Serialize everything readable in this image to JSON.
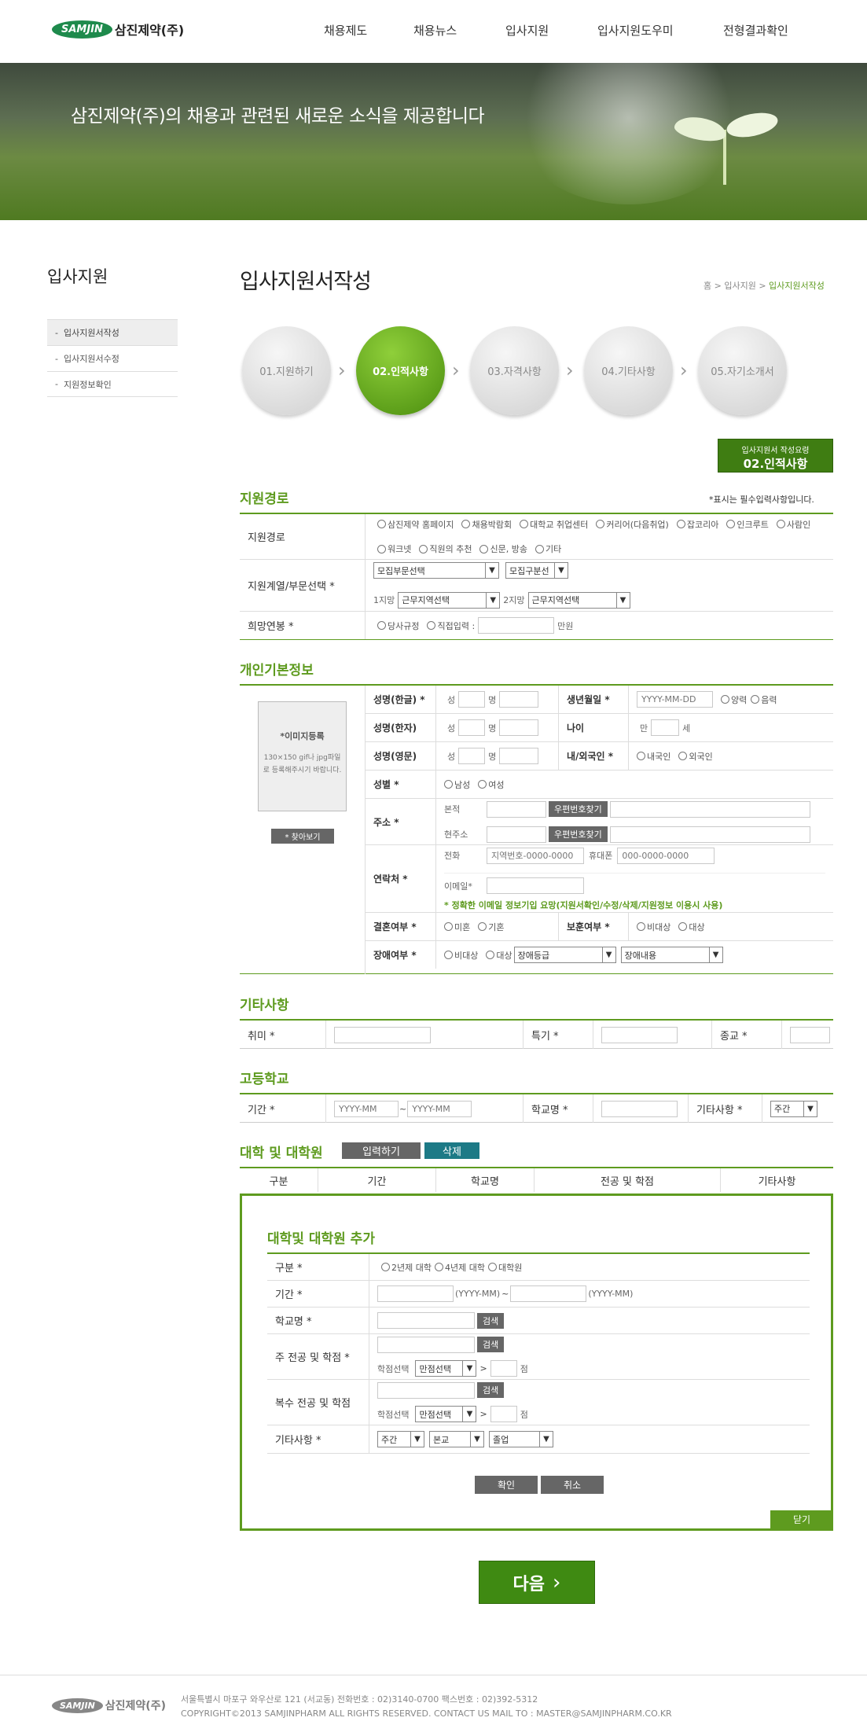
{
  "header": {
    "logo_badge": "SAMJIN",
    "logo_text": "삼진제약(주)",
    "nav": [
      "채용제도",
      "채용뉴스",
      "입사지원",
      "입사지원도우미",
      "전형결과확인"
    ]
  },
  "banner": {
    "text": "삼진제약(주)의 채용과 관련된 새로운 소식을 제공합니다"
  },
  "sidebar": {
    "title": "입사지원",
    "items": [
      "입사지원서작성",
      "입사지원서수정",
      "지원정보확인"
    ]
  },
  "page": {
    "title": "입사지원서작성",
    "breadcrumb": [
      "홈",
      "입사지원",
      "입사지원서작성"
    ]
  },
  "steps": [
    "01.지원하기",
    "02.인적사항",
    "03.자격사항",
    "04.기타사항",
    "05.자기소개서"
  ],
  "guide_button": {
    "line1": "입사지원서 작성요령",
    "line2": "02.인적사항"
  },
  "section_route": {
    "title": "지원경로",
    "required_note": "*표시는 필수입력사항입니다.",
    "route_label": "지원경로",
    "route_options": [
      "삼진제약 홈페이지",
      "채용박람회",
      "대학교 취업센터",
      "커리어(다음취업)",
      "잡코리아",
      "인크루트",
      "사람인",
      "워크넷",
      "직원의 추천",
      "신문, 방송",
      "기타"
    ],
    "dept_label": "지원계열/부문선택 *",
    "dept_select1": "모집부문선택",
    "dept_select2": "모집구분선",
    "pref1_label": "1지망",
    "pref1_select": "근무지역선택",
    "pref2_label": "2지망",
    "pref2_select": "근무지역선택",
    "salary_label": "희망연봉 *",
    "salary_options": [
      "당사규정",
      "직접입력 :"
    ],
    "salary_unit": "만원"
  },
  "section_personal": {
    "title": "개인기본정보",
    "photo_title": "*이미지등록",
    "photo_note": "130×150 gif나 jpg파일로 등록해주시기 바랍니다.",
    "photo_button": "* 찾아보기",
    "name_kr": "성명(한글) *",
    "name_hanja": "성명(한자)",
    "name_en": "성명(영문)",
    "surname": "성",
    "given": "명",
    "birth_label": "생년월일 *",
    "birth_placeholder": "YYYY-MM-DD",
    "birth_options": [
      "양력",
      "음력"
    ],
    "age_label": "나이",
    "age_prefix": "만",
    "age_suffix": "세",
    "nation_label": "내/외국인 *",
    "nation_options": [
      "내국인",
      "외국인"
    ],
    "gender_label": "성별 *",
    "gender_options": [
      "남성",
      "여성"
    ],
    "address_label": "주소 *",
    "addr1": "본적",
    "addr2": "현주소",
    "zip_button": "우편번호찾기",
    "contact_label": "연락처 *",
    "phone_label": "전화",
    "phone_placeholder": "지역번호-0000-0000",
    "mobile_label": "휴대폰",
    "mobile_placeholder": "000-0000-0000",
    "email_label": "이메일*",
    "email_note": "* 정확한 이메일 정보기입 요망(지원서확인/수정/삭제/지원정보 이용시 사용)",
    "marriage_label": "결혼여부 *",
    "marriage_options": [
      "미혼",
      "기혼"
    ],
    "veteran_label": "보훈여부 *",
    "veteran_options": [
      "비대상",
      "대상"
    ],
    "disability_label": "장애여부 *",
    "disability_options": [
      "비대상",
      "대상"
    ],
    "disability_grade": "장애등급",
    "disability_detail": "장애내용"
  },
  "section_etc": {
    "title": "기타사항",
    "hobby": "취미 *",
    "skill": "특기 *",
    "religion": "종교 *"
  },
  "section_high": {
    "title": "고등학교",
    "period": "기간 *",
    "ph": "YYYY-MM",
    "tilde": "~",
    "school": "학교명 *",
    "etc": "기타사항 *",
    "etc_select": "주간"
  },
  "section_univ": {
    "title": "대학 및 대학원",
    "input_btn": "입력하기",
    "delete_btn": "삭제",
    "cols": [
      "구분",
      "기간",
      "학교명",
      "전공 및 학점",
      "기타사항"
    ]
  },
  "univ_popup": {
    "title": "대학및 대학원 추가",
    "type_label": "구분 *",
    "type_options": [
      "2년제 대학",
      "4년제 대학",
      "대학원"
    ],
    "period_label": "기간 *",
    "period_hint": "(YYYY-MM)",
    "period_tilde": "~",
    "school_label": "학교명 *",
    "search": "검색",
    "major_label": "주 전공 및 학점 *",
    "grade_label": "학점선택",
    "grade_select": "만점선택",
    "grade_unit": "점",
    "gt": ">",
    "double_label": "복수 전공 및 학점",
    "etc_label": "기타사항 *",
    "etc_s1": "주간",
    "etc_s2": "본교",
    "etc_s3": "졸업",
    "ok": "확인",
    "cancel": "취소",
    "close": "닫기"
  },
  "next_button": "다음",
  "footer": {
    "logo_badge": "SAMJIN",
    "logo_text": "삼진제약(주)",
    "address": "서울특별시 마포구 와우산로 121 (서교동)  전화번호 : 02)3140-0700   팩스번호 : 02)392-5312",
    "copyright": "COPYRIGHT©2013 SAMJINPHARM ALL RIGHTS RESERVED. CONTACT US MAIL TO : MASTER@SAMJINPHARM.CO.KR"
  },
  "colors": {
    "accent": "#5e9b1f",
    "dark": "#666666"
  }
}
